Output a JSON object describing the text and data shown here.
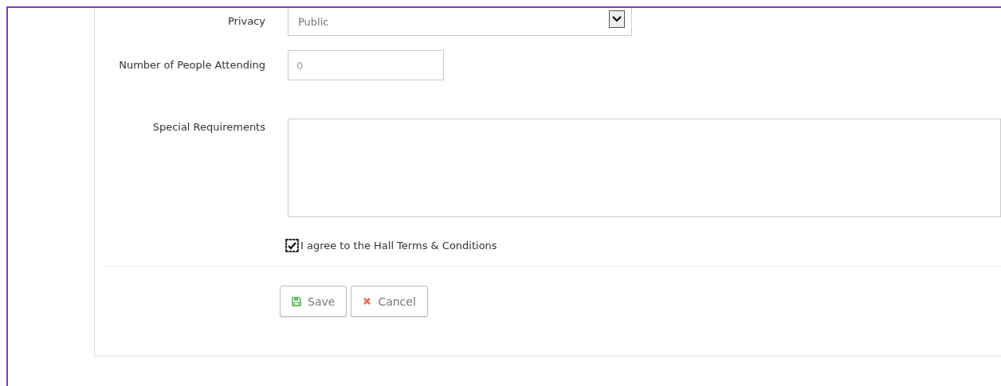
{
  "form": {
    "fields": [
      {
        "kind": "select",
        "label": "Privacy",
        "value": "Public"
      },
      {
        "kind": "number",
        "label": "Number of People Attending",
        "placeholder": "0"
      },
      {
        "kind": "textarea",
        "label": "Special Requirements"
      }
    ],
    "agreement": {
      "label": "I agree to the Hall Terms & Conditions",
      "checked": true
    },
    "buttons": [
      {
        "kind": "save",
        "label": "Save"
      },
      {
        "kind": "cancel",
        "label": "Cancel"
      }
    ]
  }
}
